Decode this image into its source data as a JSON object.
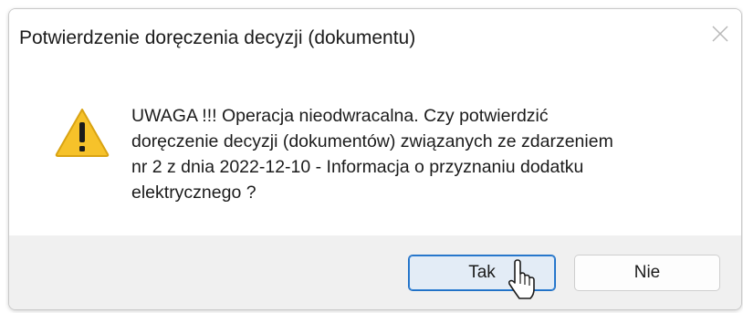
{
  "window": {
    "title": "Potwierdzenie doręczenia decyzji (dokumentu)",
    "close_icon": "close-icon"
  },
  "message": {
    "icon": "warning-icon",
    "text": "UWAGA !!! Operacja nieodwracalna. Czy potwierdzić\ndoręczenie decyzji (dokumentów) związanych ze zdarzeniem\nnr 2 z dnia 2022-12-10 - Informacja o przyznaniu dodatku\nelektrycznego ?"
  },
  "buttons": {
    "yes_label": "Tak",
    "no_label": "Nie"
  },
  "colors": {
    "accent_border": "#1f6fc4",
    "focused_button_bg": "#e3ecf6",
    "footer_bg": "#f0f0f0",
    "warning_fill": "#f6c22a"
  }
}
